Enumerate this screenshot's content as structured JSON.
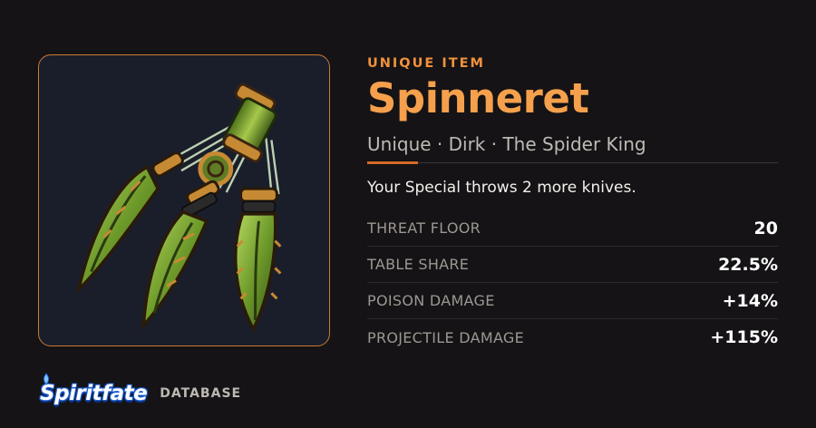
{
  "item": {
    "kicker": "UNIQUE ITEM",
    "name": "Spinneret",
    "subtitle": "Unique · Dirk · The Spider King",
    "description": "Your Special throws 2 more knives.",
    "image_icon": "triple-dirk-icon"
  },
  "stats": [
    {
      "label": "THREAT FLOOR",
      "value": "20"
    },
    {
      "label": "TABLE SHARE",
      "value": "22.5%"
    },
    {
      "label": "POISON DAMAGE",
      "value": "+14%"
    },
    {
      "label": "PROJECTILE DAMAGE",
      "value": "+115%"
    }
  ],
  "brand": {
    "logo_text": "Spiritfate",
    "suffix": "DATABASE"
  },
  "colors": {
    "accent": "#f5a04c",
    "frame_border": "#c97a34",
    "background": "#151315",
    "frame_background": "#1a1e2b"
  }
}
